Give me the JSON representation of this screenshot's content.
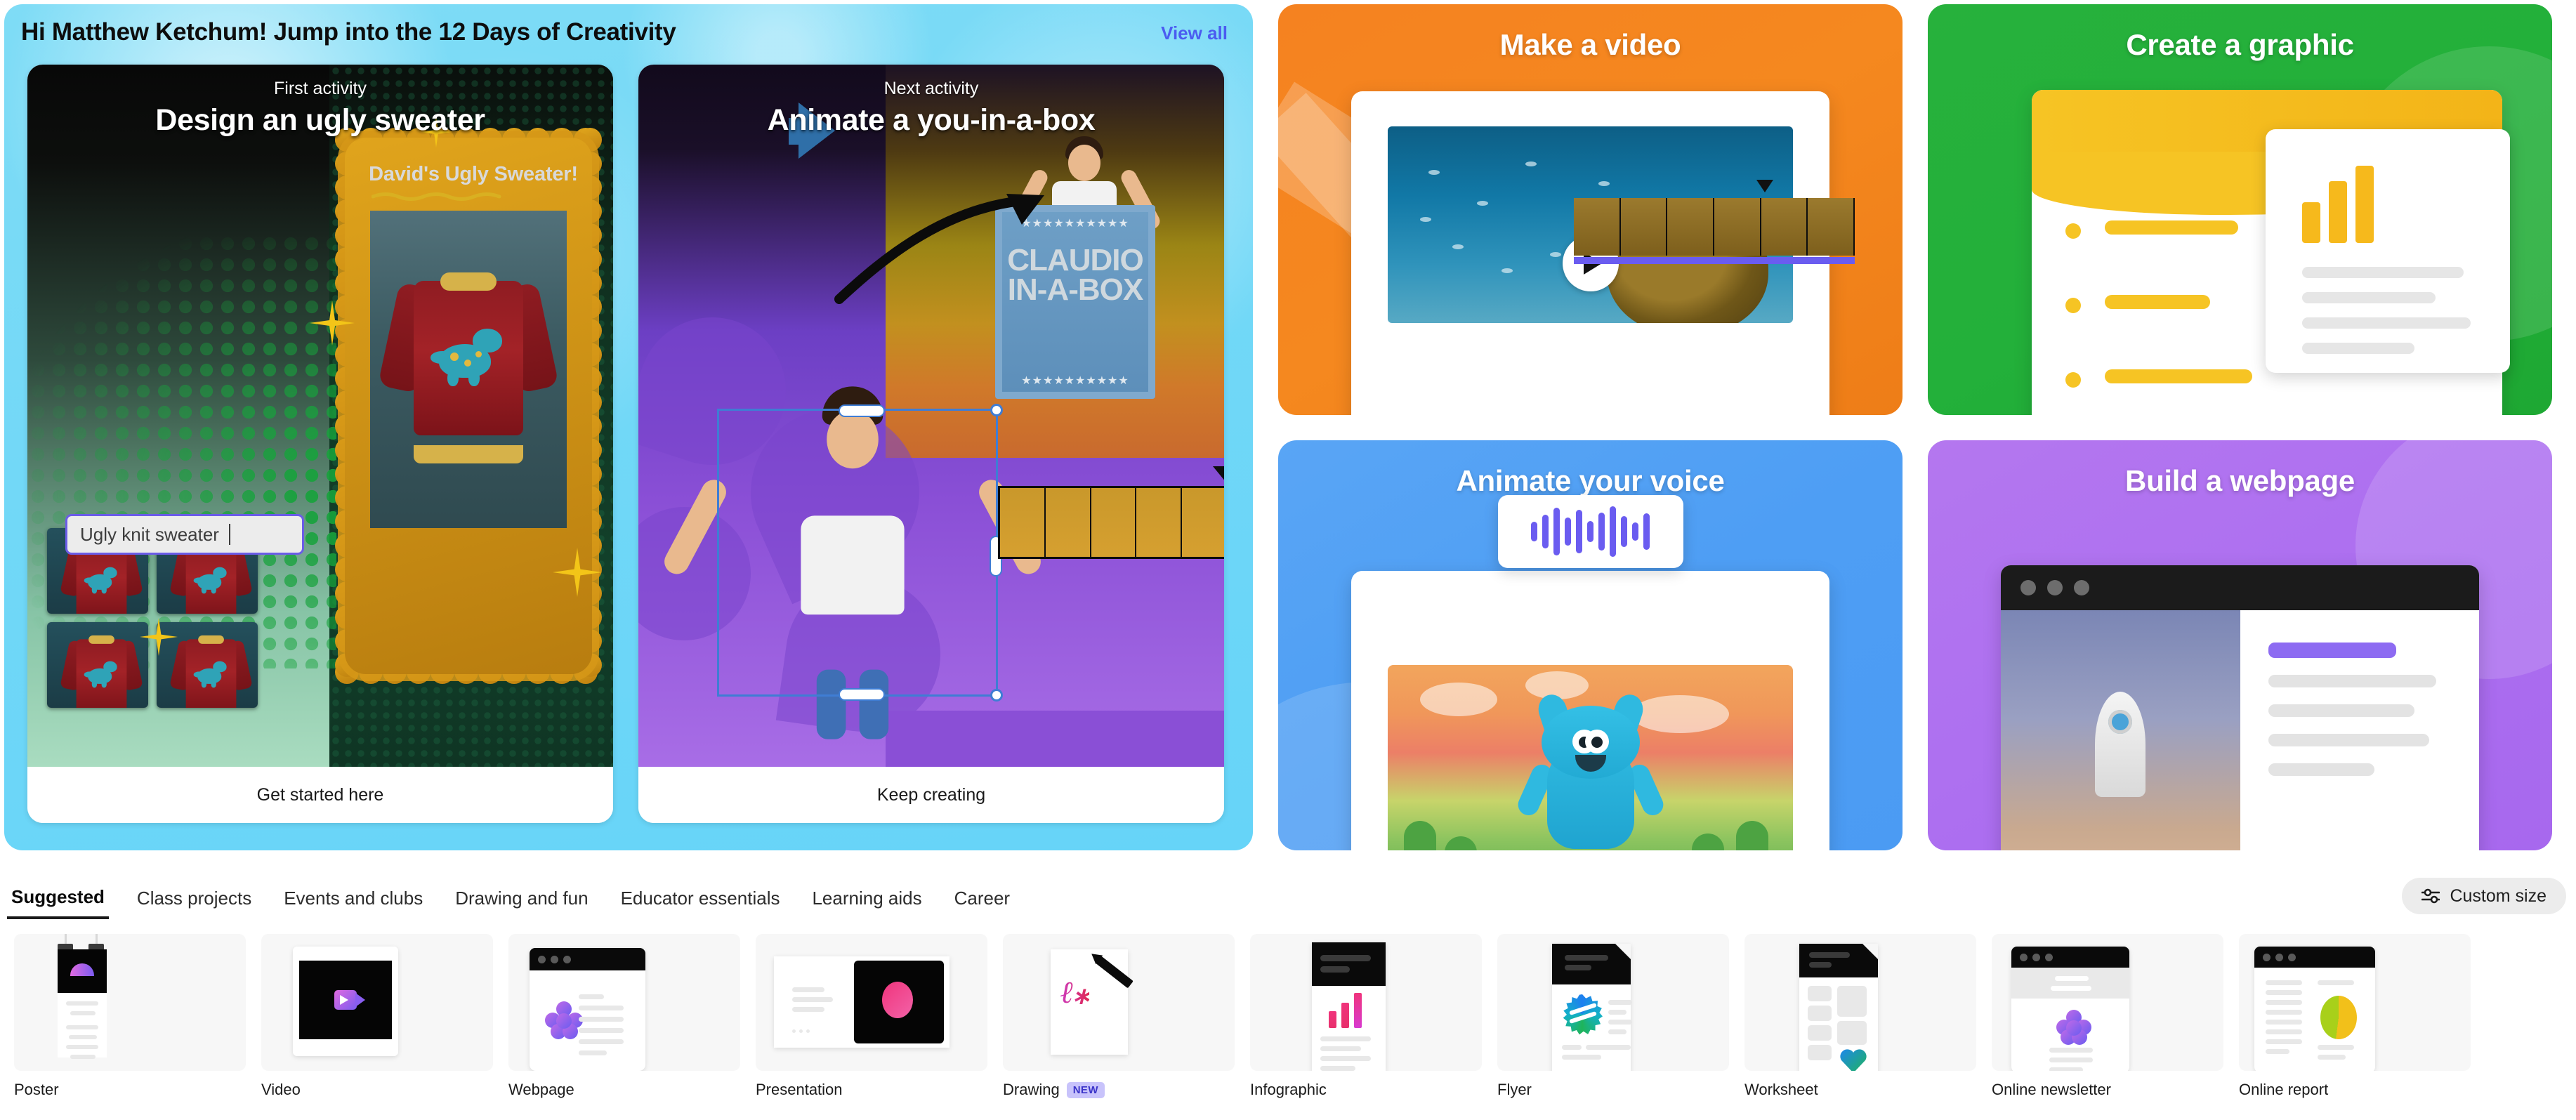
{
  "hero": {
    "greeting": "Hi Matthew Ketchum! Jump into the 12 Days of Creativity",
    "view_all": "View all",
    "activities": [
      {
        "kicker": "First activity",
        "title": "Design an ugly sweater",
        "cta": "Get started here",
        "artwork": {
          "design_title": "David's Ugly Sweater!",
          "prompt_value": "Ugly knit sweater"
        }
      },
      {
        "kicker": "Next activity",
        "title": "Animate a you-in-a-box",
        "cta": "Keep creating",
        "artwork": {
          "box_line1": "CLAUDIO",
          "box_line2": "IN-A-BOX"
        }
      }
    ]
  },
  "promos": [
    {
      "title": "Make a video",
      "color": "#f58220",
      "icon": "play-icon"
    },
    {
      "title": "Create a graphic",
      "color": "#27b13c",
      "icon": "bar-chart-icon"
    },
    {
      "title": "Animate your voice",
      "color": "#59a5f5",
      "icon": "waveform-icon"
    },
    {
      "title": "Build a webpage",
      "color": "#b477ef",
      "icon": "browser-icon"
    }
  ],
  "tabs": [
    {
      "label": "Suggested",
      "active": true
    },
    {
      "label": "Class projects",
      "active": false
    },
    {
      "label": "Events and clubs",
      "active": false
    },
    {
      "label": "Drawing and fun",
      "active": false
    },
    {
      "label": "Educator essentials",
      "active": false
    },
    {
      "label": "Learning aids",
      "active": false
    },
    {
      "label": "Career",
      "active": false
    }
  ],
  "custom_size": {
    "label": "Custom size",
    "icon": "sliders-icon"
  },
  "templates": [
    {
      "label": "Poster",
      "badge": ""
    },
    {
      "label": "Video",
      "badge": ""
    },
    {
      "label": "Webpage",
      "badge": ""
    },
    {
      "label": "Presentation",
      "badge": ""
    },
    {
      "label": "Drawing",
      "badge": "NEW"
    },
    {
      "label": "Infographic",
      "badge": ""
    },
    {
      "label": "Flyer",
      "badge": ""
    },
    {
      "label": "Worksheet",
      "badge": ""
    },
    {
      "label": "Online newsletter",
      "badge": ""
    },
    {
      "label": "Online report",
      "badge": ""
    }
  ],
  "colors": {
    "hero_bg": "#72d8f7",
    "link": "#4b5cf0",
    "badge_new_bg": "#c8c3fb",
    "badge_new_text": "#3b34c9"
  }
}
